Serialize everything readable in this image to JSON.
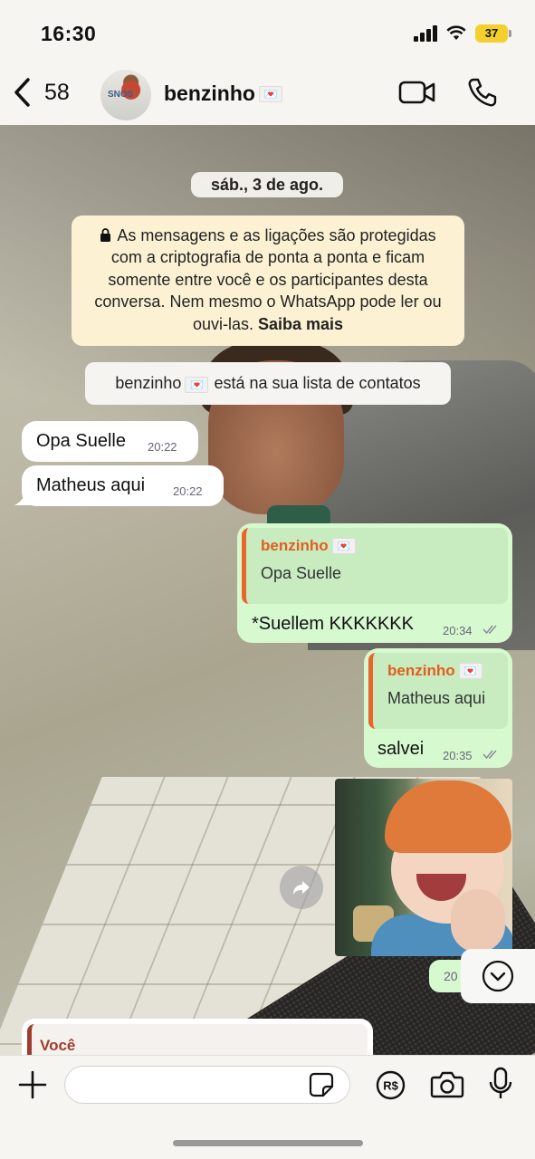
{
  "status_bar": {
    "time": "16:30",
    "battery": "37"
  },
  "header": {
    "back_count": "58",
    "avatar_text": "SNOS",
    "contact_name": "benzinho",
    "heart": "💌"
  },
  "chat": {
    "date": "sáb., 3 de ago.",
    "encryption_notice": "As mensagens e as ligações são protegidas com a criptografia de ponta a ponta e ficam somente entre você e os participantes desta conversa. Nem mesmo o WhatsApp pode ler ou ouvi-las.",
    "learn_more": "Saiba mais",
    "contact_notice_name": "benzinho",
    "contact_notice_text": "está na sua lista de contatos",
    "messages": [
      {
        "text": "Opa Suelle",
        "time": "20:22"
      },
      {
        "text": "Matheus aqui",
        "time": "20:22"
      },
      {
        "quote_name": "benzinho",
        "quote_text": "Opa Suelle",
        "text": "*Suellem KKKKKKK",
        "time": "20:34"
      },
      {
        "quote_name": "benzinho",
        "quote_text": "Matheus aqui",
        "text": "salvei",
        "time": "20:35"
      }
    ],
    "sticker_time_partial": "20",
    "partial_quote_name": "Você"
  },
  "input_bar": {
    "placeholder": ""
  },
  "colors": {
    "outgoing": "#d7f9cf",
    "incoming": "#ffffff",
    "quote_accent": "#e8662a",
    "notice": "#fcf2d3"
  }
}
